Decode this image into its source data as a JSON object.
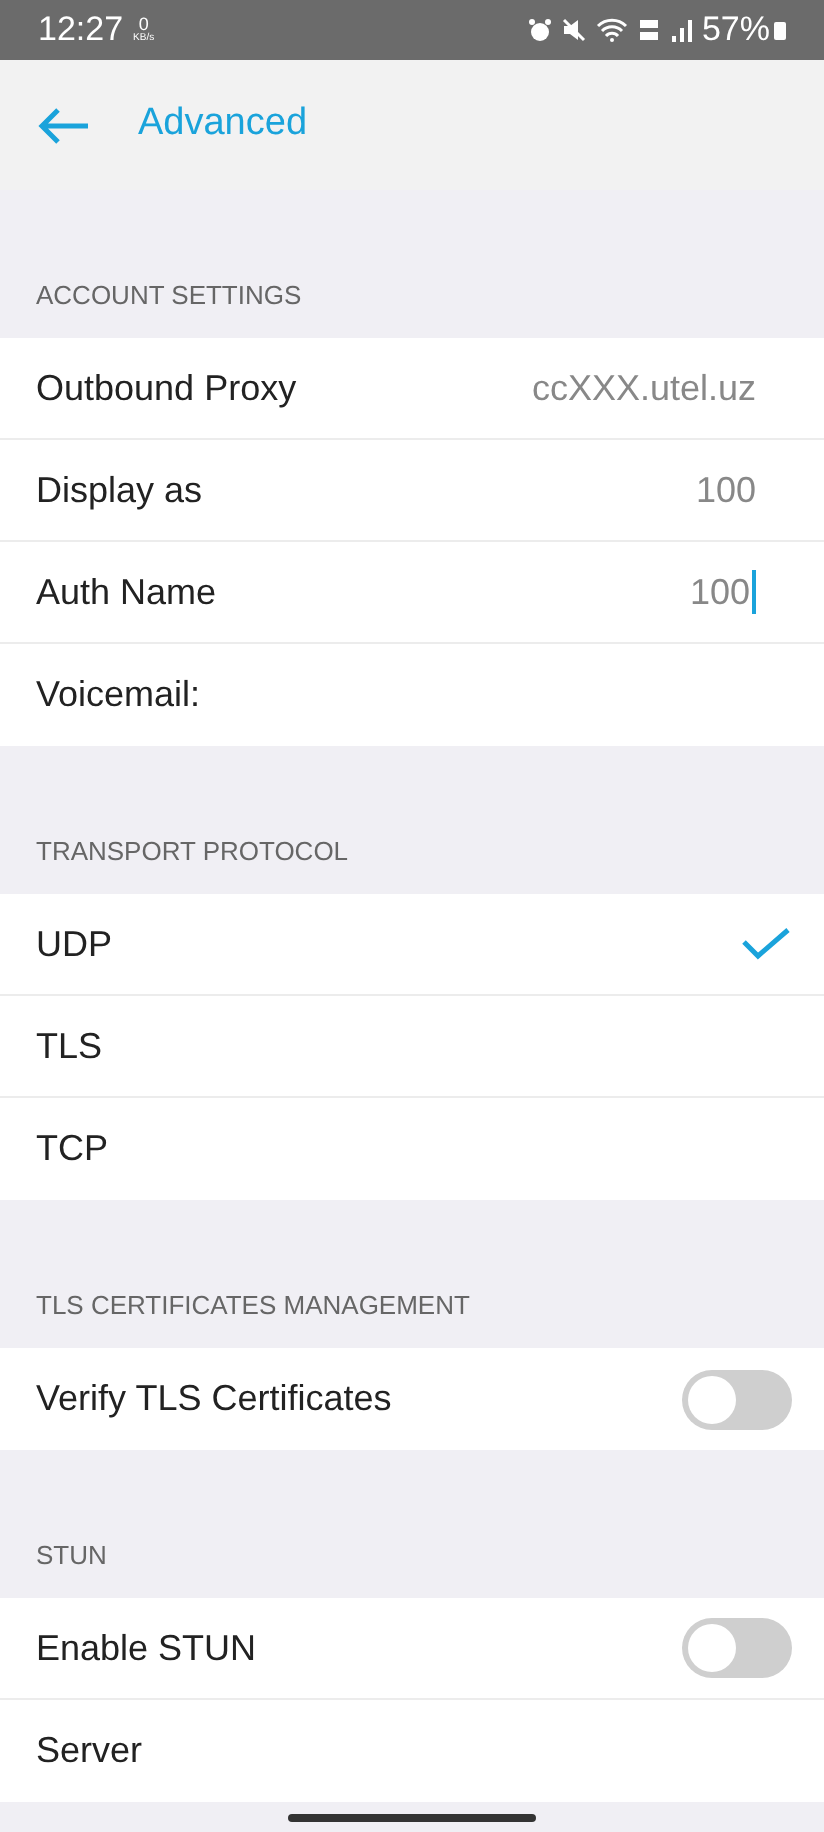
{
  "status_bar": {
    "time": "12:27",
    "speed_value": "0",
    "speed_unit": "KB/s",
    "battery": "57%"
  },
  "header": {
    "title": "Advanced"
  },
  "sections": [
    {
      "title": "ACCOUNT SETTINGS",
      "rows": [
        {
          "kind": "field",
          "label": "Outbound Proxy",
          "value": "ccXXX.utel.uz",
          "focused": false
        },
        {
          "kind": "field",
          "label": "Display as",
          "value": "100",
          "focused": false
        },
        {
          "kind": "field",
          "label": "Auth Name",
          "value": "100",
          "focused": true
        },
        {
          "kind": "field",
          "label": "Voicemail:",
          "focused": false
        }
      ]
    },
    {
      "title": "TRANSPORT PROTOCOL",
      "rows": [
        {
          "kind": "choice",
          "label": "UDP",
          "selected": true
        },
        {
          "kind": "choice",
          "label": "TLS",
          "selected": false
        },
        {
          "kind": "choice",
          "label": "TCP",
          "selected": false
        }
      ]
    },
    {
      "title": "TLS CERTIFICATES MANAGEMENT",
      "rows": [
        {
          "kind": "toggle",
          "label": "Verify TLS Certificates",
          "on": false
        }
      ]
    },
    {
      "title": "STUN",
      "rows": [
        {
          "kind": "toggle",
          "label": "Enable STUN",
          "on": false
        },
        {
          "kind": "field",
          "label": "Server",
          "focused": false
        }
      ]
    }
  ]
}
